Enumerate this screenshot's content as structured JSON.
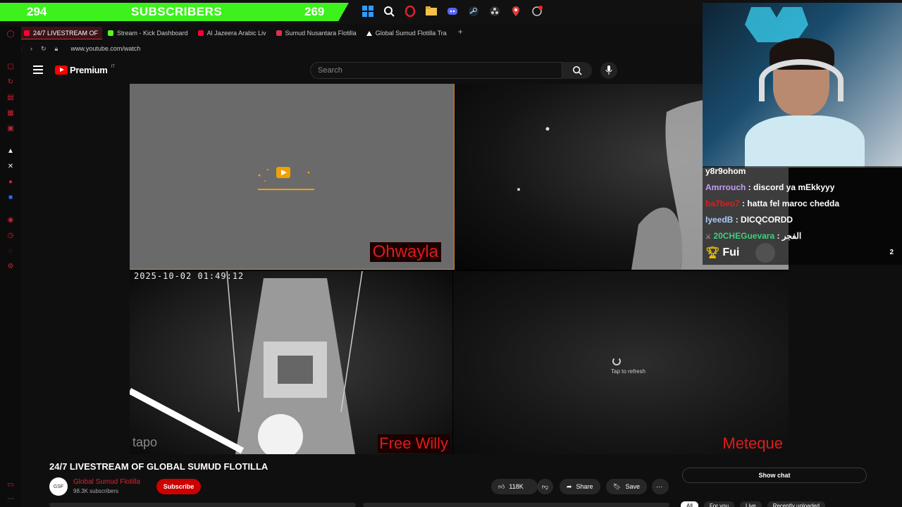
{
  "overlay": {
    "subs_left": "294",
    "subs_label": "SUBSCRIBERS",
    "subs_right": "269",
    "bar_color": "#3df21c"
  },
  "browser": {
    "tabs": [
      {
        "label": "24/7 LIVESTREAM OF",
        "icon": "youtube-icon",
        "color": "#ff0033"
      },
      {
        "label": "Stream - Kick Dashboard",
        "icon": "kick-icon",
        "color": "#53fc18"
      },
      {
        "label": "Al Jazeera Arabic Liv",
        "icon": "youtube-icon",
        "color": "#ff0033"
      },
      {
        "label": "Sumud Nusantara Flotilla",
        "icon": "flag-icon",
        "color": "#e0304a"
      },
      {
        "label": "Global Sumud Flotilla Tra",
        "icon": "triangle-icon",
        "color": "#ffffff"
      }
    ],
    "url": "www.youtube.com/watch"
  },
  "youtube": {
    "logo_text": "Premium",
    "country_code": "IT",
    "search_placeholder": "Search"
  },
  "video": {
    "cam1_label": "Ohwayla",
    "cam3_timestamp": "2025-10-02 01:49:12",
    "cam3_label": "Free Willy",
    "cam3_watermark": "tapo",
    "cam4_label": "Meteque",
    "cam4_refresh": "Tap to refresh"
  },
  "chat": {
    "lines": [
      {
        "user": "y8r9ohom",
        "user_color": "#ffffff",
        "msg": ""
      },
      {
        "user": "Amrrouch",
        "user_color": "#c79bff",
        "msg": " : discord ya mEkkyyy"
      },
      {
        "user": "ba7beo7",
        "user_color": "#e01b1b",
        "msg": " : hatta fel maroc chedda"
      },
      {
        "user": "IyeedB",
        "user_color": "#a9c9ff",
        "msg": " : DICQCORDD"
      },
      {
        "user": "20CHEGuevara",
        "user_color": "#3fd07a",
        "msg": " : الفجر"
      }
    ],
    "trophy_text": "Fui",
    "count": "2"
  },
  "info": {
    "title": "24/7 LIVESTREAM OF GLOBAL SUMUD FLOTILLA",
    "channel": "Global Sumud Flotilla",
    "subscribers": "98.3K subscribers",
    "subscribe": "Subscribe",
    "likes": "118K",
    "share": "Share",
    "save": "Save",
    "show_chat": "Show chat",
    "chips": [
      "All",
      "For you",
      "Live",
      "Recently uploaded"
    ]
  }
}
